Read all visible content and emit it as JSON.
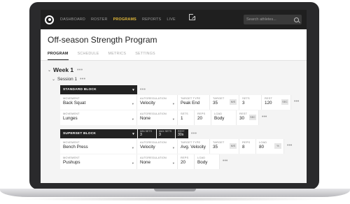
{
  "nav": {
    "items": [
      "DASHBOARD",
      "ROSTER",
      "PROGRAMS",
      "REPORTS",
      "LIVE"
    ],
    "search_placeholder": "Search athletes..."
  },
  "page": {
    "title": "Off-season Strength Program",
    "tabs": [
      "PROGRAM",
      "SCHEDULE",
      "METRICS",
      "SETTINGS"
    ]
  },
  "week": {
    "title": "Week 1"
  },
  "session": {
    "title": "Session 1"
  },
  "blocks": {
    "standard": {
      "title": "STANDARD BLOCK",
      "row1": {
        "movement_label": "MOVEMENT",
        "movement": "Back Squat",
        "auto_label": "AUTOREGULATION",
        "auto": "Velocity",
        "ttype_label": "TARGET TYPE",
        "ttype": "Peak End",
        "target_label": "TARGET",
        "target": "35",
        "target_unit": "M/S",
        "sets_label": "SETS",
        "sets": "3",
        "rest_label": "REST",
        "rest": "120",
        "rest_unit": "SEC"
      },
      "row2": {
        "movement_label": "MOVEMENT",
        "movement": "Lunges",
        "auto_label": "AUTOREGULATION",
        "auto": "None",
        "sets_label": "SETS",
        "sets": "1",
        "reps_label": "REPS",
        "reps": "20",
        "load_label": "LOAD",
        "load": "Body",
        "rest_label": "REST",
        "rest": "30",
        "rest_unit": "SEC"
      }
    },
    "superset": {
      "title": "SUPERSET BLOCK",
      "min_sets_label": "MIN SETS",
      "min_sets": "3",
      "max_sets_label": "MAX SETS",
      "max_sets": "3",
      "rest_label": "REST",
      "rest": "30s",
      "row1": {
        "movement_label": "MOVEMENT",
        "movement": "Bench Press",
        "auto_label": "AUTOREGULATION",
        "auto": "Velocity",
        "ttype_label": "TARGET TYPE",
        "ttype": "Avg. Velocity",
        "target_label": "TARGET",
        "target": "35",
        "target_unit": "M/S",
        "reps_label": "REPS",
        "reps": "8",
        "load_label": "LOAD",
        "load": "80",
        "load_unit": "%"
      },
      "row2": {
        "movement_label": "MOVEMENT",
        "movement": "Pushups",
        "auto_label": "AUTOREGULATION",
        "auto": "None",
        "reps_label": "REPS",
        "reps": "20",
        "load_label": "LOAD",
        "load": "Body"
      }
    }
  },
  "colors": {
    "nav_bg": "#1f1f1f",
    "accent": "#e2b93b",
    "block_header": "#222222"
  }
}
